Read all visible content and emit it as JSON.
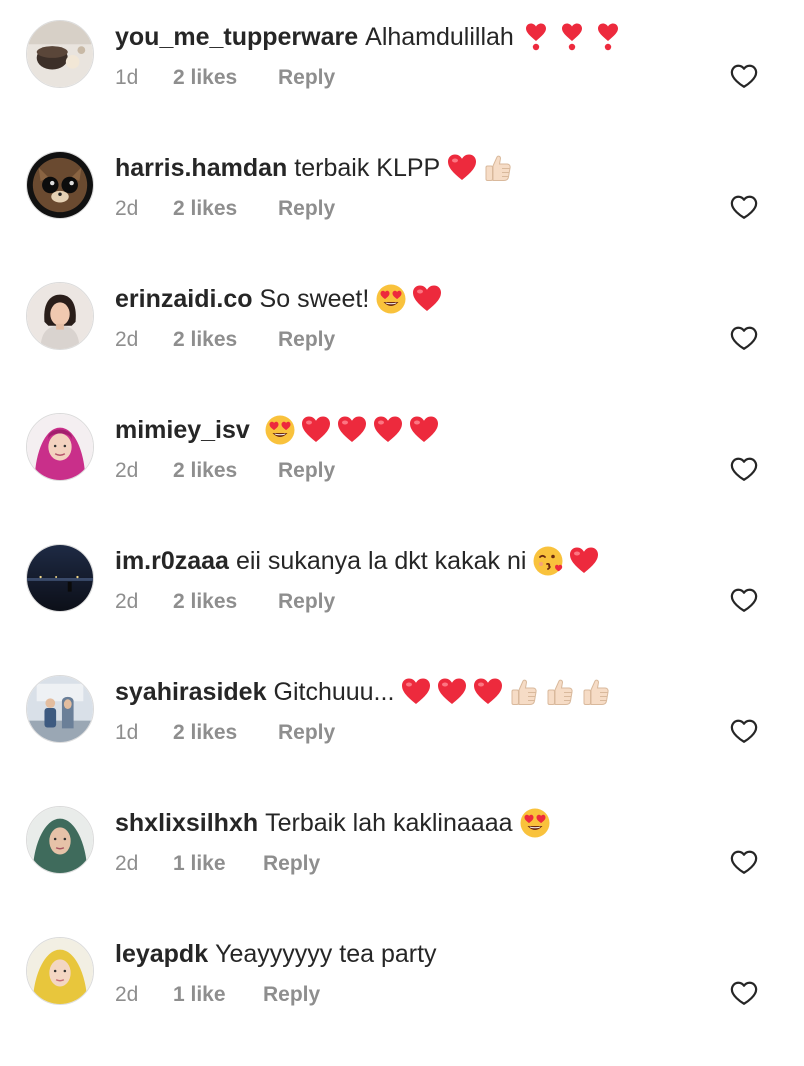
{
  "comments": [
    {
      "username": "you_me_tupperware",
      "text": "Alhamdulillah",
      "emojis": [
        "heavy-exclamation-heart",
        "heavy-exclamation-heart",
        "heavy-exclamation-heart"
      ],
      "time": "1d",
      "likes": "2 likes",
      "reply": "Reply",
      "avatar": "tupperware-avatar"
    },
    {
      "username": "harris.hamdan",
      "text": "terbaik KLPP",
      "emojis": [
        "red-heart",
        "thumbs-up"
      ],
      "time": "2d",
      "likes": "2 likes",
      "reply": "Reply",
      "avatar": "cat-avatar"
    },
    {
      "username": "erinzaidi.co",
      "text": "So sweet!",
      "emojis": [
        "heart-eyes",
        "red-heart"
      ],
      "time": "2d",
      "likes": "2 likes",
      "reply": "Reply",
      "avatar": "girl-avatar"
    },
    {
      "username": "mimiey_isv",
      "text": "",
      "emojis": [
        "heart-eyes",
        "red-heart",
        "red-heart",
        "red-heart",
        "red-heart"
      ],
      "time": "2d",
      "likes": "2 likes",
      "reply": "Reply",
      "avatar": "hijab-pink-avatar"
    },
    {
      "username": "im.r0zaaa",
      "text": "eii sukanya la dkt kakak ni",
      "emojis": [
        "kissing-heart",
        "red-heart"
      ],
      "time": "2d",
      "likes": "2 likes",
      "reply": "Reply",
      "avatar": "night-avatar"
    },
    {
      "username": "syahirasidek",
      "text": "Gitchuuu...",
      "emojis": [
        "red-heart",
        "red-heart",
        "red-heart",
        "thumbs-up",
        "thumbs-up",
        "thumbs-up"
      ],
      "time": "1d",
      "likes": "2 likes",
      "reply": "Reply",
      "avatar": "family-avatar"
    },
    {
      "username": "shxlixsilhxh",
      "text": "Terbaik lah kaklinaaaa",
      "emojis": [
        "heart-eyes"
      ],
      "time": "2d",
      "likes": "1 like",
      "reply": "Reply",
      "avatar": "hijab-green-avatar"
    },
    {
      "username": "leyapdk",
      "text": "Yeayyyyyy tea party",
      "emojis": [],
      "time": "2d",
      "likes": "1 like",
      "reply": "Reply",
      "avatar": "hijab-yellow-avatar"
    }
  ],
  "icons": {
    "like": "heart-outline-icon"
  },
  "colors": {
    "username": "#262626",
    "meta": "#8e8e8e",
    "heart": "#ed2a3d",
    "thumb": "#f6dcc6"
  }
}
